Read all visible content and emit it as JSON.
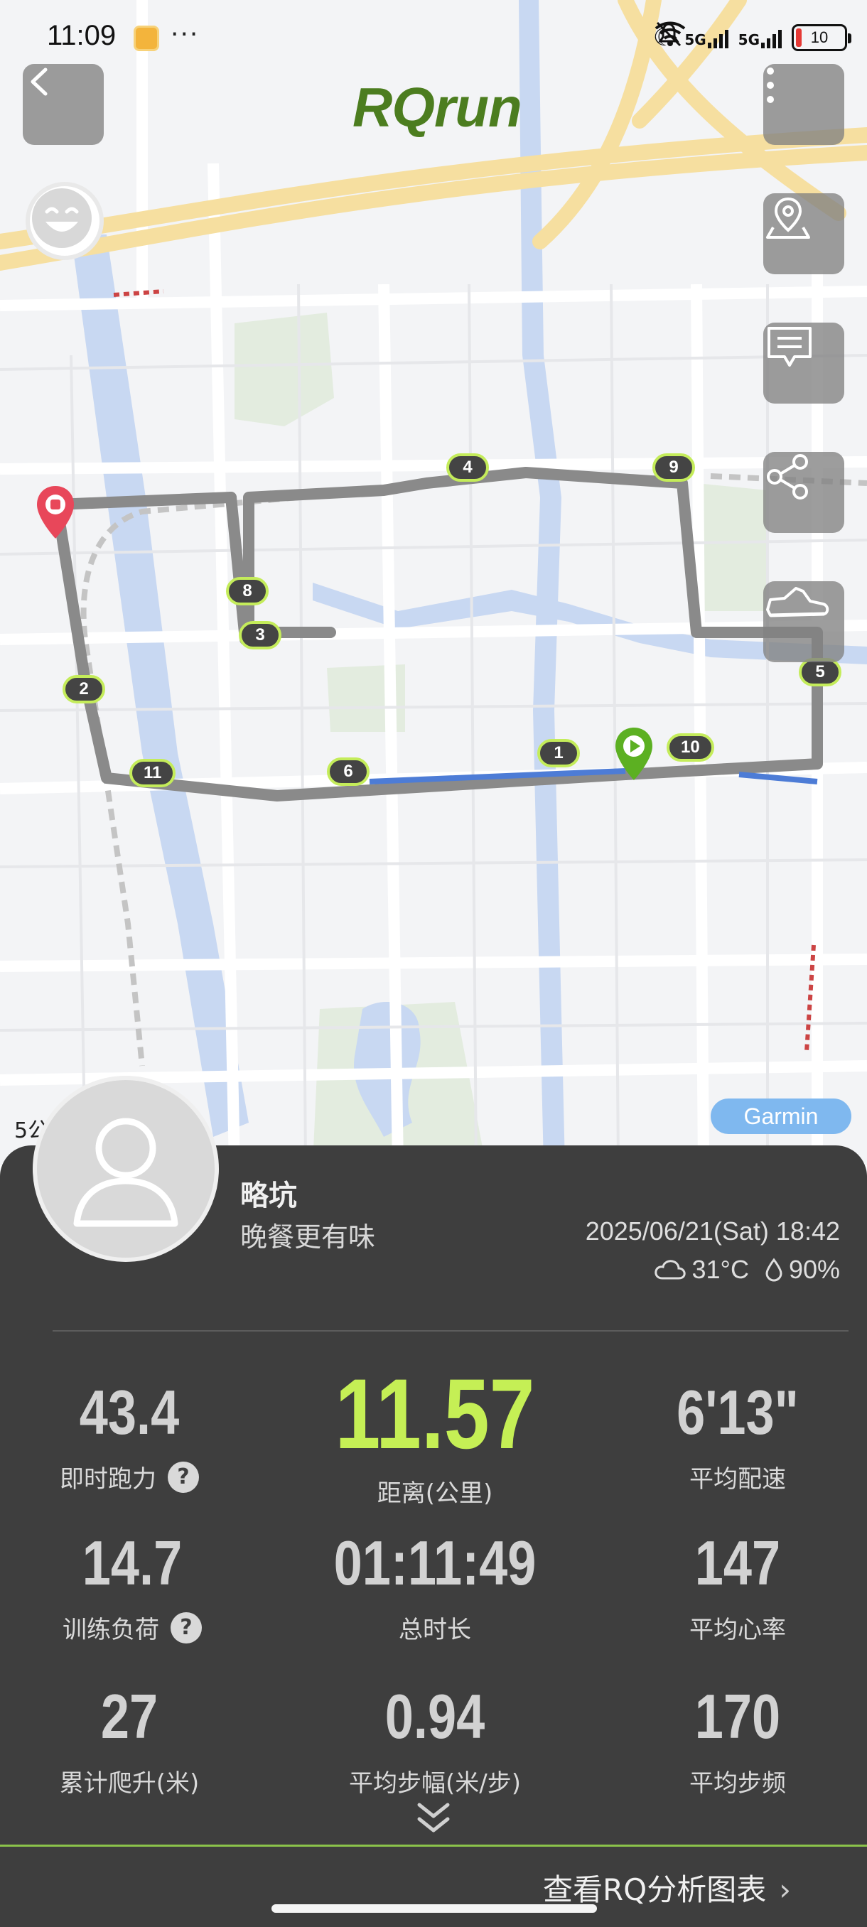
{
  "status_bar": {
    "time": "11:09",
    "more": "···",
    "network_1": "5G",
    "network_2": "5G",
    "battery": "10"
  },
  "header": {
    "brand": "RQrun"
  },
  "map": {
    "provider_badge": "Garmin",
    "scale_label": "5公",
    "route_color": "#8a8a8a",
    "km_markers": [
      "1",
      "2",
      "3",
      "4",
      "5",
      "6",
      "8",
      "9",
      "10",
      "11"
    ]
  },
  "activity": {
    "user_name": "略坑",
    "title": "晚餐更有味",
    "datetime": "2025/06/21(Sat) 18:42",
    "temperature": "31°C",
    "humidity": "90%"
  },
  "stats": {
    "running_power": {
      "value": "43.4",
      "label": "即时跑力"
    },
    "distance": {
      "value": "11.57",
      "label": "距离(公里)"
    },
    "avg_pace": {
      "value": "6'13\"",
      "label": "平均配速"
    },
    "training_load": {
      "value": "14.7",
      "label": "训练负荷"
    },
    "total_time": {
      "value": "01:11:49",
      "label": "总时长"
    },
    "avg_heart_rate": {
      "value": "147",
      "label": "平均心率"
    },
    "elevation_gain": {
      "value": "27",
      "label": "累计爬升(米)"
    },
    "avg_stride": {
      "value": "0.94",
      "label": "平均步幅(米/步)"
    },
    "avg_cadence": {
      "value": "170",
      "label": "平均步频"
    }
  },
  "footer": {
    "analysis_link": "查看RQ分析图表",
    "accent_color": "#c5ef55"
  }
}
